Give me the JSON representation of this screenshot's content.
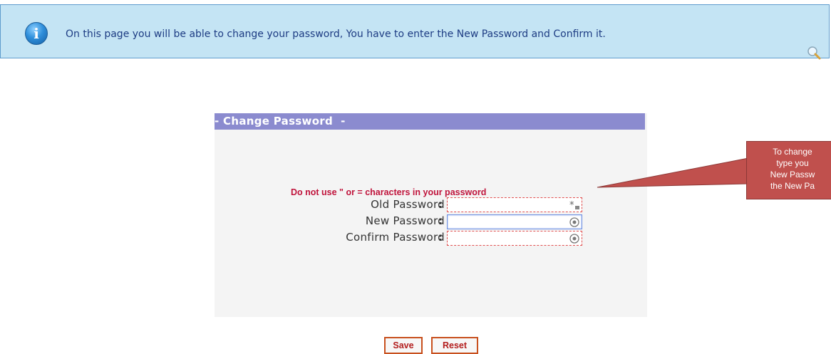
{
  "banner": {
    "text": "On this page you will be able to change your password, You have to enter the New Password and Confirm it.",
    "icon": "info-icon"
  },
  "panel": {
    "title": "- Change Password  -",
    "warning": "Do not use \" or = characters in your password",
    "fields": [
      {
        "label": "Old Password",
        "colon": ":",
        "value": "",
        "icon": "password-mask-icon"
      },
      {
        "label": "New Password",
        "colon": ":",
        "value": "",
        "icon": "password-reveal-icon"
      },
      {
        "label": "Confirm Password",
        "colon": ":",
        "value": "",
        "icon": "password-reveal-icon"
      }
    ],
    "buttons": {
      "save": "Save",
      "reset": "Reset"
    }
  },
  "callout": {
    "lines": [
      "To change",
      "type you",
      "New Passw",
      "the New Pa"
    ],
    "color": "#c0504d"
  },
  "colors": {
    "banner_bg": "#c4e4f4",
    "header_bg": "#8b8bcf",
    "warning": "#c0143c",
    "button_border": "#c8501e"
  }
}
